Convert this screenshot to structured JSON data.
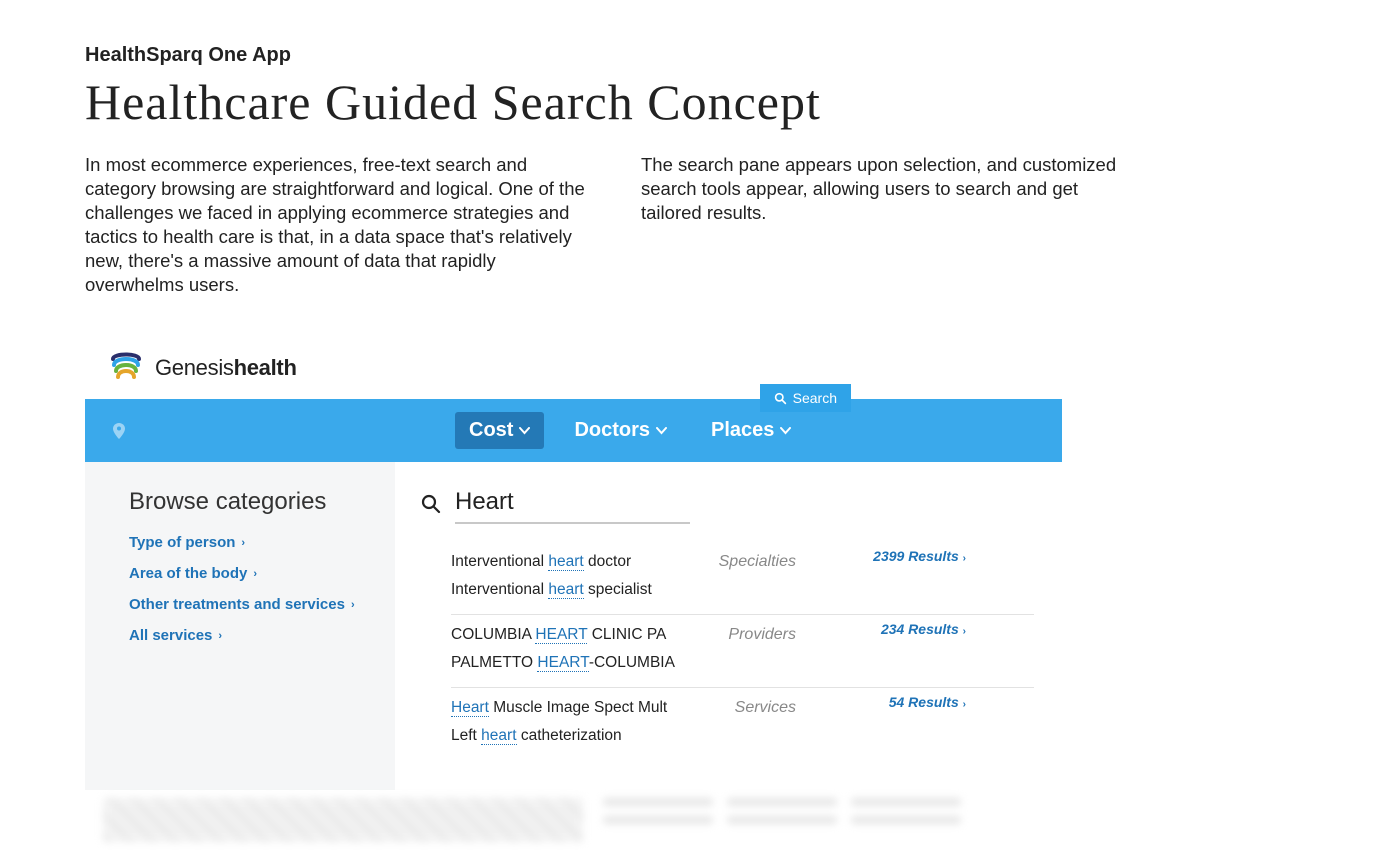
{
  "header": {
    "eyebrow": "HealthSparq One App",
    "title": "Healthcare Guided Search Concept",
    "col1": "In most ecommerce experiences, free-text search and category browsing are straightforward and logical. One of the challenges we faced in applying ecommerce strategies and tactics to health care is that, in a data space that's relatively new, there's a massive amount of data that rapidly overwhelms users.",
    "col2": "The search pane appears upon selection, and customized search tools appear, allowing users to search and get tailored results."
  },
  "brand": {
    "name_light": "Genesis",
    "name_bold": "health"
  },
  "search_tab": "Search",
  "nav": {
    "items": [
      {
        "label": "Cost",
        "active": true
      },
      {
        "label": "Doctors",
        "active": false
      },
      {
        "label": "Places",
        "active": false
      }
    ]
  },
  "browse": {
    "title": "Browse categories",
    "links": [
      "Type of person",
      "Area of the body",
      "Other treatments and services",
      "All services"
    ]
  },
  "search": {
    "query": "Heart",
    "groups": [
      {
        "label": "Specialties",
        "count": "2399 Results",
        "lines": [
          {
            "pre": "Interventional ",
            "hl": "heart",
            "post": " doctor"
          },
          {
            "pre": "Interventional ",
            "hl": "heart",
            "post": " specialist"
          }
        ]
      },
      {
        "label": "Providers",
        "count": "234 Results",
        "lines": [
          {
            "pre": "COLUMBIA ",
            "hl": "HEART",
            "post": " CLINIC PA"
          },
          {
            "pre": "PALMETTO ",
            "hl": "HEART",
            "post": "-COLUMBIA"
          }
        ]
      },
      {
        "label": "Services",
        "count": "54 Results",
        "lines": [
          {
            "pre": "",
            "hl": "Heart",
            "post": " Muscle Image Spect Mult"
          },
          {
            "pre": "Left ",
            "hl": "heart",
            "post": " catheterization"
          }
        ]
      }
    ]
  }
}
